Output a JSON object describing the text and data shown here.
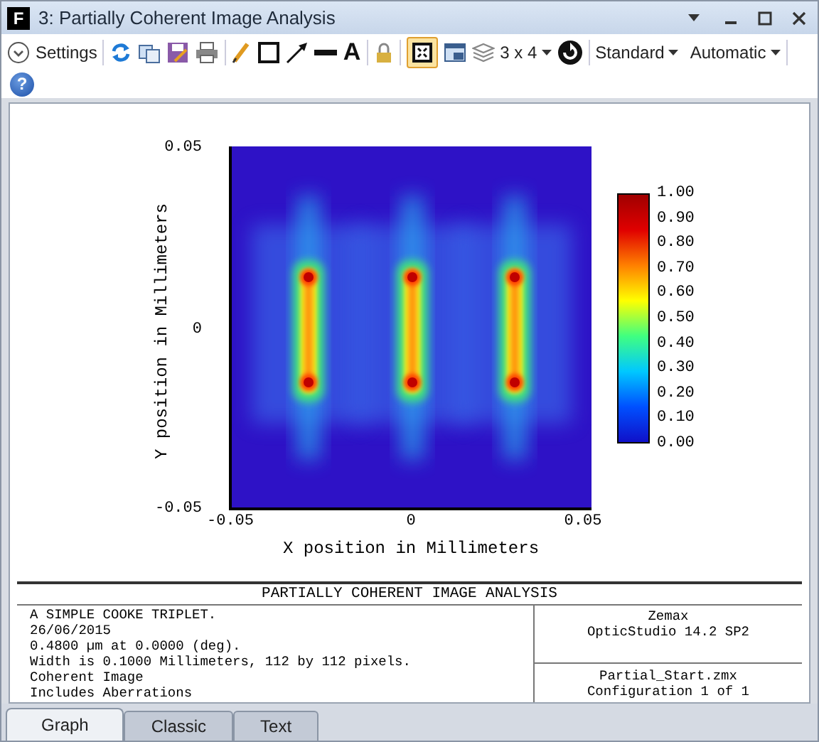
{
  "window": {
    "logo_letter": "F",
    "title": "3: Partially Coherent Image Analysis"
  },
  "toolbar": {
    "settings": "Settings",
    "text_tool": "A",
    "fit_toggle_on": true,
    "layout": "3 x 4",
    "dropdowns": [
      "Standard",
      "Automatic"
    ],
    "help": "?"
  },
  "plot": {
    "y_ticks": [
      "0.05",
      "0",
      "-0.05"
    ],
    "x_ticks": [
      "-0.05",
      "0",
      "0.05"
    ],
    "ylabel": "Y position in Millimeters",
    "xlabel": "X position in Millimeters",
    "colorbar_labels": [
      "1.00",
      "0.90",
      "0.80",
      "0.70",
      "0.60",
      "0.50",
      "0.40",
      "0.30",
      "0.20",
      "0.10",
      "0.00"
    ]
  },
  "info": {
    "title": "PARTIALLY COHERENT IMAGE ANALYSIS",
    "lines": [
      "A SIMPLE COOKE TRIPLET.",
      "26/06/2015",
      "0.4800 µm at 0.0000 (deg).",
      "Width is 0.1000 Millimeters, 112 by 112 pixels.",
      "Coherent Image",
      "Includes Aberrations"
    ],
    "program": [
      "Zemax",
      "OpticStudio 14.2 SP2"
    ],
    "file": [
      "Partial_Start.zmx",
      "Configuration 1 of 1"
    ]
  },
  "tabs": [
    {
      "label": "Graph",
      "selected": true
    },
    {
      "label": "Classic",
      "selected": false
    },
    {
      "label": "Text",
      "selected": false
    }
  ]
}
